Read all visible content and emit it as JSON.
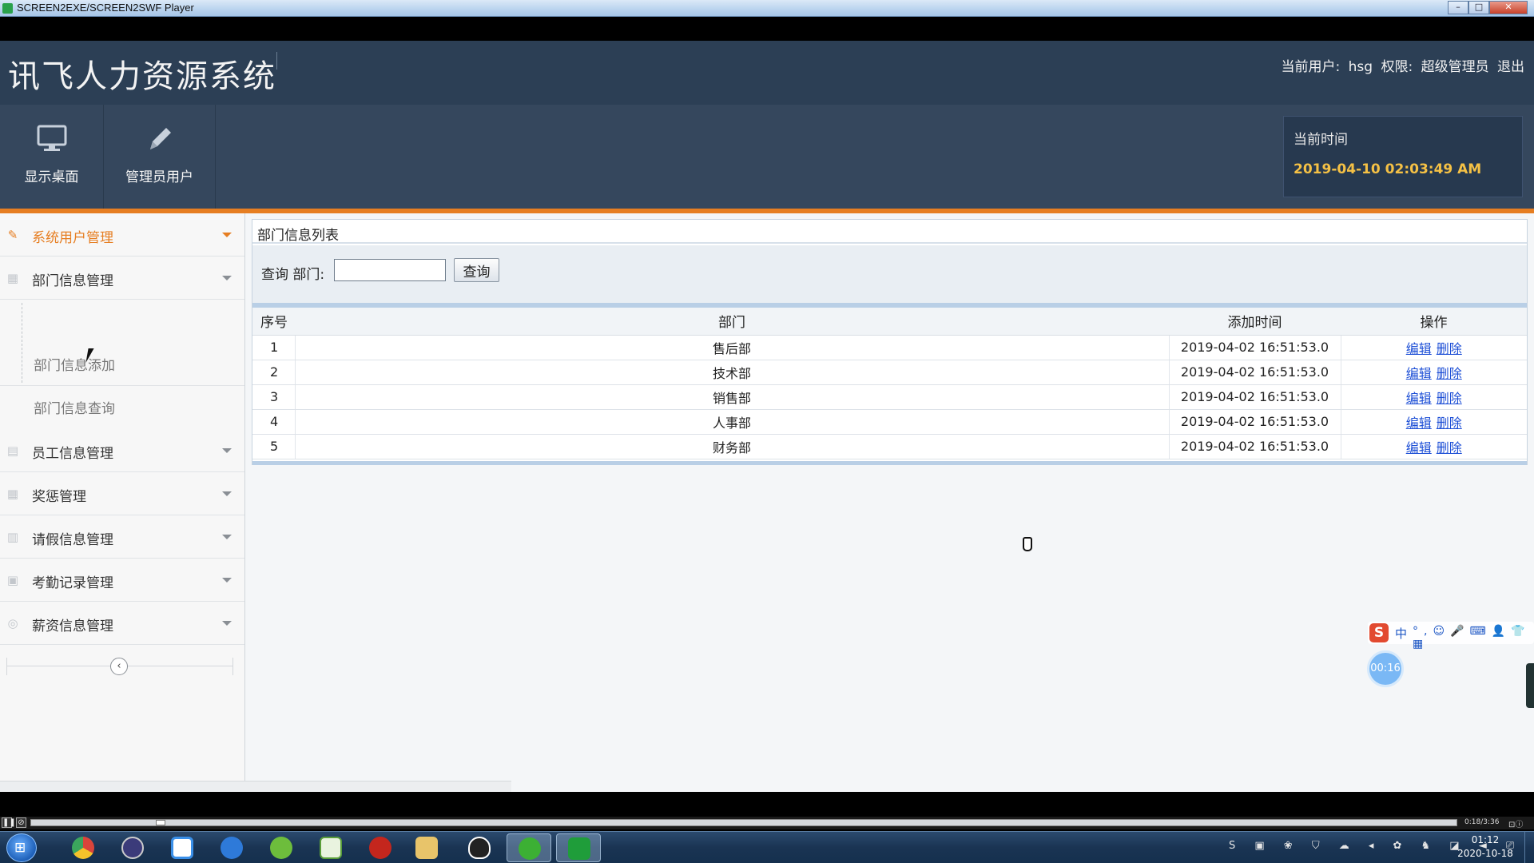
{
  "window": {
    "title": "SCREEN2EXE/SCREEN2SWF Player",
    "controls": [
      "–",
      "□",
      "✕"
    ]
  },
  "app": {
    "title": "讯飞人力资源系统",
    "user_label": "当前用户:",
    "user_name": "hsg",
    "role_label": "权限:",
    "role_value": "超级管理员",
    "logout": "退出"
  },
  "toolbar": {
    "buttons": [
      {
        "label": "显示桌面",
        "icon": "monitor-icon"
      },
      {
        "label": "管理员用户",
        "icon": "pencil-icon"
      }
    ],
    "time_label": "当前时间",
    "time_value": "2019-04-10 02:03:49 AM"
  },
  "sidebar": {
    "items": [
      {
        "label": "系统用户管理",
        "icon": "pencil-icon",
        "active": true
      },
      {
        "label": "部门信息管理",
        "icon": "grid-icon",
        "expanded": true
      },
      {
        "label": "员工信息管理",
        "icon": "list-icon"
      },
      {
        "label": "奖惩管理",
        "icon": "grid-icon"
      },
      {
        "label": "请假信息管理",
        "icon": "table-icon"
      },
      {
        "label": "考勤记录管理",
        "icon": "calendar-icon"
      },
      {
        "label": "薪资信息管理",
        "icon": "circle-icon"
      }
    ],
    "submenu": [
      "部门信息添加",
      "部门信息查询"
    ],
    "collapse": "‹"
  },
  "panel": {
    "title": "部门信息列表",
    "search_label": "查询 部门:",
    "search_value": "",
    "search_button": "查询",
    "columns": [
      "序号",
      "部门",
      "添加时间",
      "操作"
    ],
    "rows": [
      {
        "seq": "1",
        "dept": "售后部",
        "time": "2019-04-02 16:51:53.0",
        "edit": "编辑",
        "del": "删除"
      },
      {
        "seq": "2",
        "dept": "技术部",
        "time": "2019-04-02 16:51:53.0",
        "edit": "编辑",
        "del": "删除"
      },
      {
        "seq": "3",
        "dept": "销售部",
        "time": "2019-04-02 16:51:53.0",
        "edit": "编辑",
        "del": "删除"
      },
      {
        "seq": "4",
        "dept": "人事部",
        "time": "2019-04-02 16:51:53.0",
        "edit": "编辑",
        "del": "删除"
      },
      {
        "seq": "5",
        "dept": "财务部",
        "time": "2019-04-02 16:51:53.0",
        "edit": "编辑",
        "del": "删除"
      }
    ]
  },
  "ime": {
    "logo": "S",
    "mode": "中",
    "icons": "°,☺🎤⌨👤👕▦"
  },
  "timer": "00:16",
  "player": {
    "time": "0:18/3:36",
    "pause": "❚❚",
    "stop": "⊘",
    "right": "⊡ⓘ"
  },
  "taskbar": {
    "start": "⊞",
    "apps": [
      {
        "name": "chrome",
        "color": "#d9453b"
      },
      {
        "name": "eclipse",
        "color": "#3b3b7a"
      },
      {
        "name": "baidu-netdisk",
        "color": "#3a8fe8"
      },
      {
        "name": "browser",
        "color": "#2e7ad9"
      },
      {
        "name": "leaf-app",
        "color": "#6dbd3c"
      },
      {
        "name": "chart-app",
        "color": "#5a9e3a"
      },
      {
        "name": "flash",
        "color": "#c4261d"
      },
      {
        "name": "explorer",
        "color": "#e8c46a"
      },
      {
        "name": "qq",
        "color": "#222222"
      },
      {
        "name": "wechat",
        "color": "#3cb034"
      },
      {
        "name": "recorder",
        "color": "#1f9d3a"
      }
    ],
    "tray": "S ▣ ❀ ⛉ ☁ ◂ ✿ ♞ ◪ ◄ ⎚",
    "time": "01:12",
    "date": "2020-10-18"
  },
  "colors": {
    "accent": "#e67e22",
    "header": "#2c3f55",
    "link": "#1d4fd6",
    "time": "#f5c145"
  }
}
